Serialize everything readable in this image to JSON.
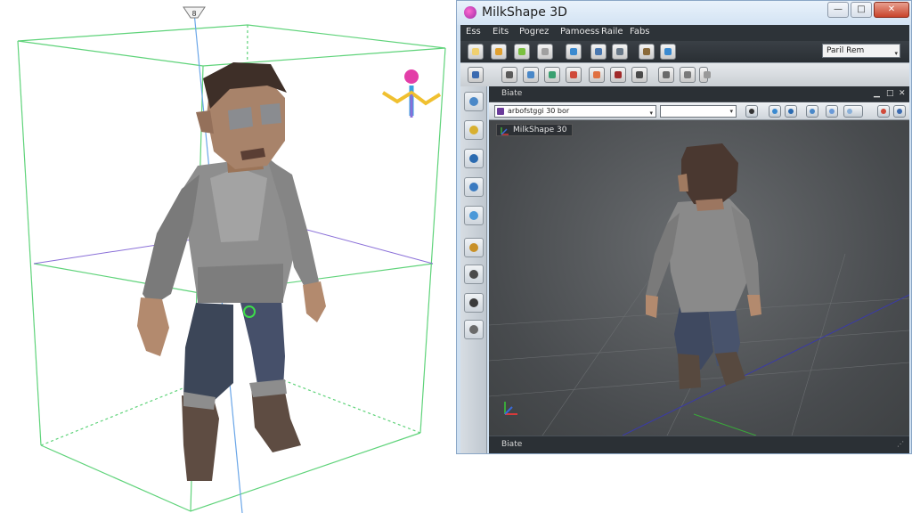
{
  "window": {
    "title": "MilkShape 3D",
    "icon": "milkshape-logo-icon",
    "controls": {
      "minimize": "—",
      "maximize": "□",
      "close": "✕"
    }
  },
  "menu": {
    "items": [
      "Ess",
      "Eits",
      "Pogrez",
      "Pamoess",
      "Raile",
      "Fabs"
    ]
  },
  "view_select": {
    "value": "Paril Rem",
    "arrow": "▾"
  },
  "toolbar_1_icons": [
    "new-file-icon",
    "open-icon",
    "wand-icon",
    "eraser-icon",
    "bug-icon",
    "tag-icon",
    "monitor-icon",
    "grid-icon",
    "gear-icon"
  ],
  "toolbar_2_icons": [
    "select-icon",
    "move-icon",
    "rotate-icon",
    "scale-icon",
    "paint-icon",
    "joint-icon",
    "vertex-icon",
    "face-icon",
    "sphere-icon",
    "link-icon",
    "weld-icon"
  ],
  "side_tools": [
    "magnify-icon",
    "lasso-icon",
    "zoom-icon",
    "bucket-icon",
    "mountain-icon",
    "cross-icon",
    "pen-icon",
    "flat-icon",
    "bookmark-icon"
  ],
  "viewport": {
    "title": "Biate",
    "controls": {
      "minimize": "▁",
      "maximize": "□",
      "close": "✕"
    },
    "model_select": "arbofstggi 30 bor",
    "model_select_arrow": "▾",
    "second_select_arrow": "▾",
    "label": "MilkShape 30",
    "status": "Biate",
    "grip": "⋰"
  },
  "left_scene": {
    "gizmo_top_label": "8"
  },
  "colors": {
    "accent": "#2a6ab0",
    "bounding_box": "#5fd37a",
    "axis_blue": "#6aa6e8",
    "axis_purple": "#8a6fd8"
  }
}
